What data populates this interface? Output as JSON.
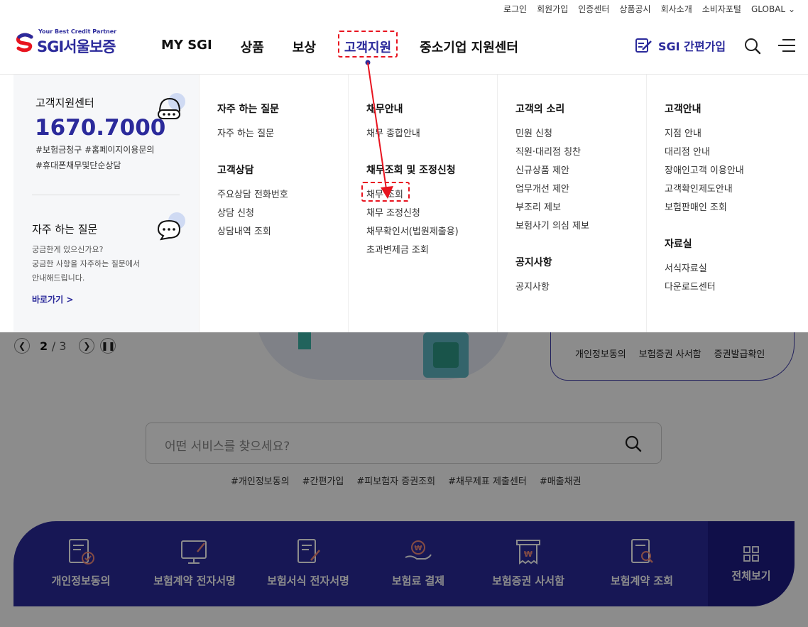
{
  "util_links": [
    "로그인",
    "회원가입",
    "인증센터",
    "상품공시",
    "회사소개",
    "소비자포털",
    "GLOBAL"
  ],
  "logo": {
    "tagline": "Your Best Credit Partner",
    "wordmark": "SGI서울보증"
  },
  "gnb": [
    "MY SGI",
    "상품",
    "보상",
    "고객지원",
    "중소기업 지원센터"
  ],
  "gnb_active_index": 3,
  "quick_join": "SGI 간편가입",
  "mega": {
    "center": {
      "title": "고객지원센터",
      "phone": "1670.7000",
      "tags_line1": "#보험금청구 #홈페이지이용문의",
      "tags_line2": "#휴대폰채무및단순상담"
    },
    "faq_box": {
      "title": "자주 하는 질문",
      "desc1": "궁금한게 있으신가요?",
      "desc2": "궁금한 사항을 자주하는 질문에서",
      "desc3": "안내해드립니다.",
      "link": "바로가기 >"
    },
    "col1": {
      "sec1_title": "자주 하는 질문",
      "sec1_links": [
        "자주 하는 질문"
      ],
      "sec2_title": "고객상담",
      "sec2_links": [
        "주요상담 전화번호",
        "상담 신청",
        "상담내역 조회"
      ]
    },
    "col2": {
      "sec1_title": "채무안내",
      "sec1_links": [
        "채무 종합안내"
      ],
      "sec2_title": "채무조회 및 조정신청",
      "sec2_links": [
        "채무 조회",
        "채무 조정신청",
        "채무확인서(법원제출용)",
        "초과변제금 조회"
      ]
    },
    "col3": {
      "sec1_title": "고객의 소리",
      "sec1_links": [
        "민원 신청",
        "직원·대리점 칭찬",
        "신규상품 제안",
        "업무개선 제안",
        "부조리 제보",
        "보험사기 의심 제보"
      ],
      "sec2_title": "공지사항",
      "sec2_links": [
        "공지사항"
      ]
    },
    "col4": {
      "sec1_title": "고객안내",
      "sec1_links": [
        "지점 안내",
        "대리점 안내",
        "장애인고객 이용안내",
        "고객확인제도안내",
        "보험판매인 조회"
      ],
      "sec2_title": "자료실",
      "sec2_links": [
        "서식자료실",
        "다운로드센터"
      ]
    }
  },
  "carousel": {
    "current": "2",
    "total": "/ 3"
  },
  "side_links": [
    "개인정보동의",
    "보험증권 사서함",
    "증권발급확인"
  ],
  "search": {
    "placeholder": "어떤 서비스를 찾으세요?"
  },
  "tags": [
    "#개인정보동의",
    "#간편가입",
    "#피보험자 증권조회",
    "#채무제표 제출센터",
    "#매출채권"
  ],
  "quick_menu": [
    "개인정보동의",
    "보험계약 전자서명",
    "보험서식 전자서명",
    "보험료 결제",
    "보험증권 사서함",
    "보험계약 조회"
  ],
  "quick_all": "전체보기",
  "colors": {
    "brand": "#2b2a9b",
    "highlight": "#e8141f"
  }
}
